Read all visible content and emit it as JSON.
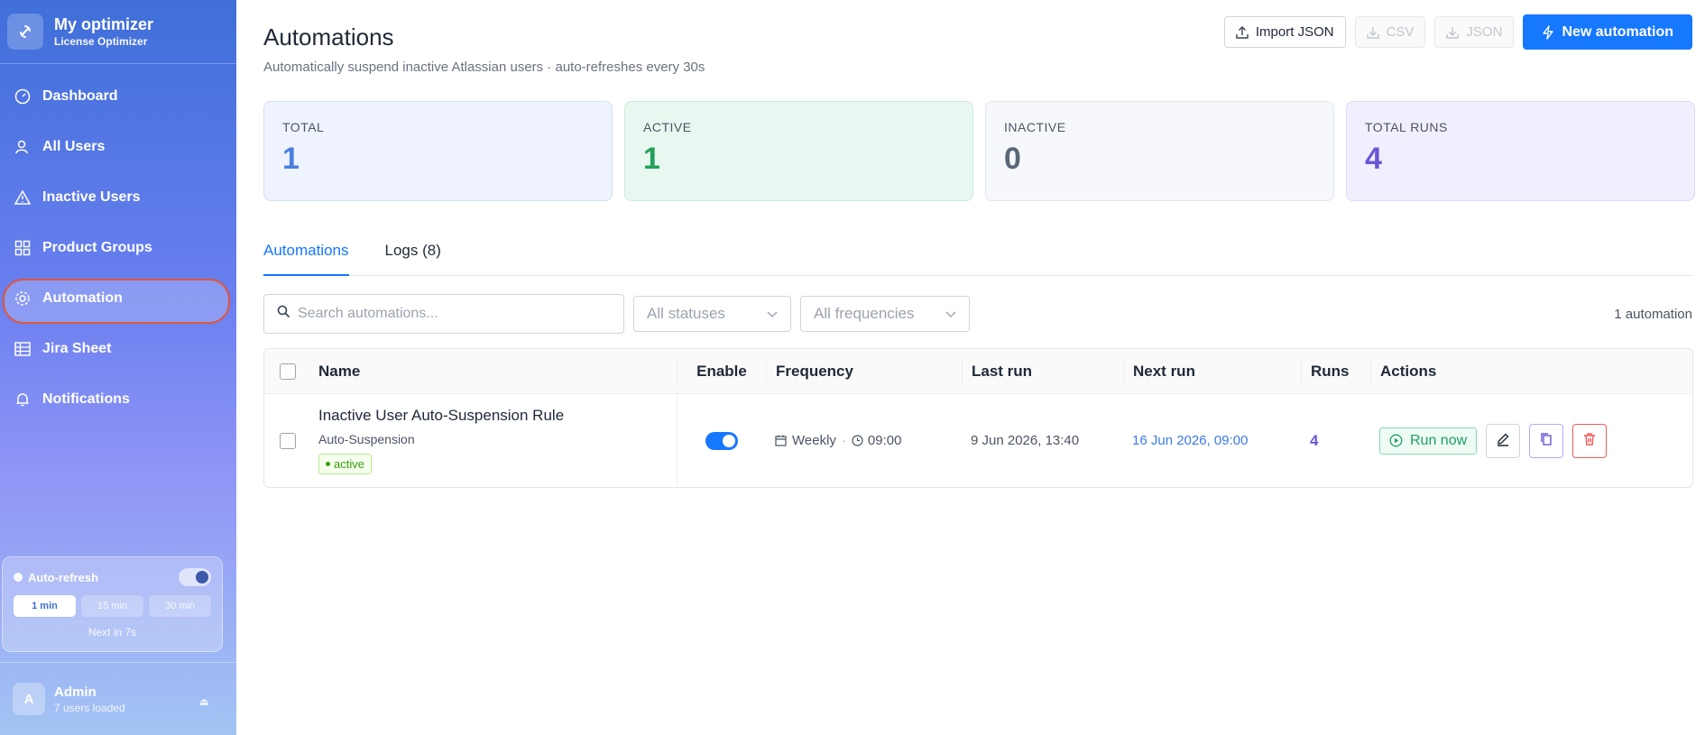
{
  "sidebar": {
    "brand_title": "My optimizer",
    "brand_subtitle": "License Optimizer",
    "items": [
      {
        "label": "Dashboard",
        "icon": "dashboard-icon"
      },
      {
        "label": "All Users",
        "icon": "users-icon"
      },
      {
        "label": "Inactive Users",
        "icon": "warning-icon"
      },
      {
        "label": "Product Groups",
        "icon": "grid-icon"
      },
      {
        "label": "Automation",
        "icon": "gear-icon",
        "active": true
      },
      {
        "label": "Jira Sheet",
        "icon": "table-icon"
      },
      {
        "label": "Notifications",
        "icon": "bell-icon"
      }
    ],
    "refresh": {
      "label": "Auto-refresh",
      "intervals": [
        "1 min",
        "15 min",
        "30 min"
      ],
      "selected": "1 min",
      "next_text": "Next in 7s"
    },
    "user": {
      "initial": "A",
      "name": "Admin",
      "sub": "7 users loaded"
    }
  },
  "header": {
    "title": "Automations",
    "subtitle": "Automatically suspend inactive Atlassian users · auto-refreshes every 30s",
    "import_label": "Import JSON",
    "csv_label": "CSV",
    "json_label": "JSON",
    "new_label": "New automation"
  },
  "stats": [
    {
      "label": "TOTAL",
      "value": "1"
    },
    {
      "label": "ACTIVE",
      "value": "1"
    },
    {
      "label": "INACTIVE",
      "value": "0"
    },
    {
      "label": "TOTAL RUNS",
      "value": "4"
    }
  ],
  "tabs": [
    {
      "label": "Automations",
      "active": true
    },
    {
      "label": "Logs (8)",
      "active": false
    }
  ],
  "filters": {
    "search_placeholder": "Search automations...",
    "status": "All statuses",
    "frequency": "All frequencies",
    "count": "1 automation"
  },
  "table": {
    "headers": {
      "name": "Name",
      "enable": "Enable",
      "frequency": "Frequency",
      "last_run": "Last run",
      "next_run": "Next run",
      "runs": "Runs",
      "actions": "Actions"
    },
    "rows": [
      {
        "name": "Inactive User Auto-Suspension Rule",
        "category": "Auto-Suspension",
        "status": "active",
        "enabled": true,
        "frequency": "Weekly",
        "time": "09:00",
        "last_run": "9 Jun 2026, 13:40",
        "next_run": "16 Jun 2026, 09:00",
        "runs": "4",
        "run_label": "Run now"
      }
    ]
  },
  "colors": {
    "accent": "#1677ff",
    "active_green": "#22a05a",
    "runs_purple": "#6b55d6",
    "danger": "#f05a5a"
  }
}
